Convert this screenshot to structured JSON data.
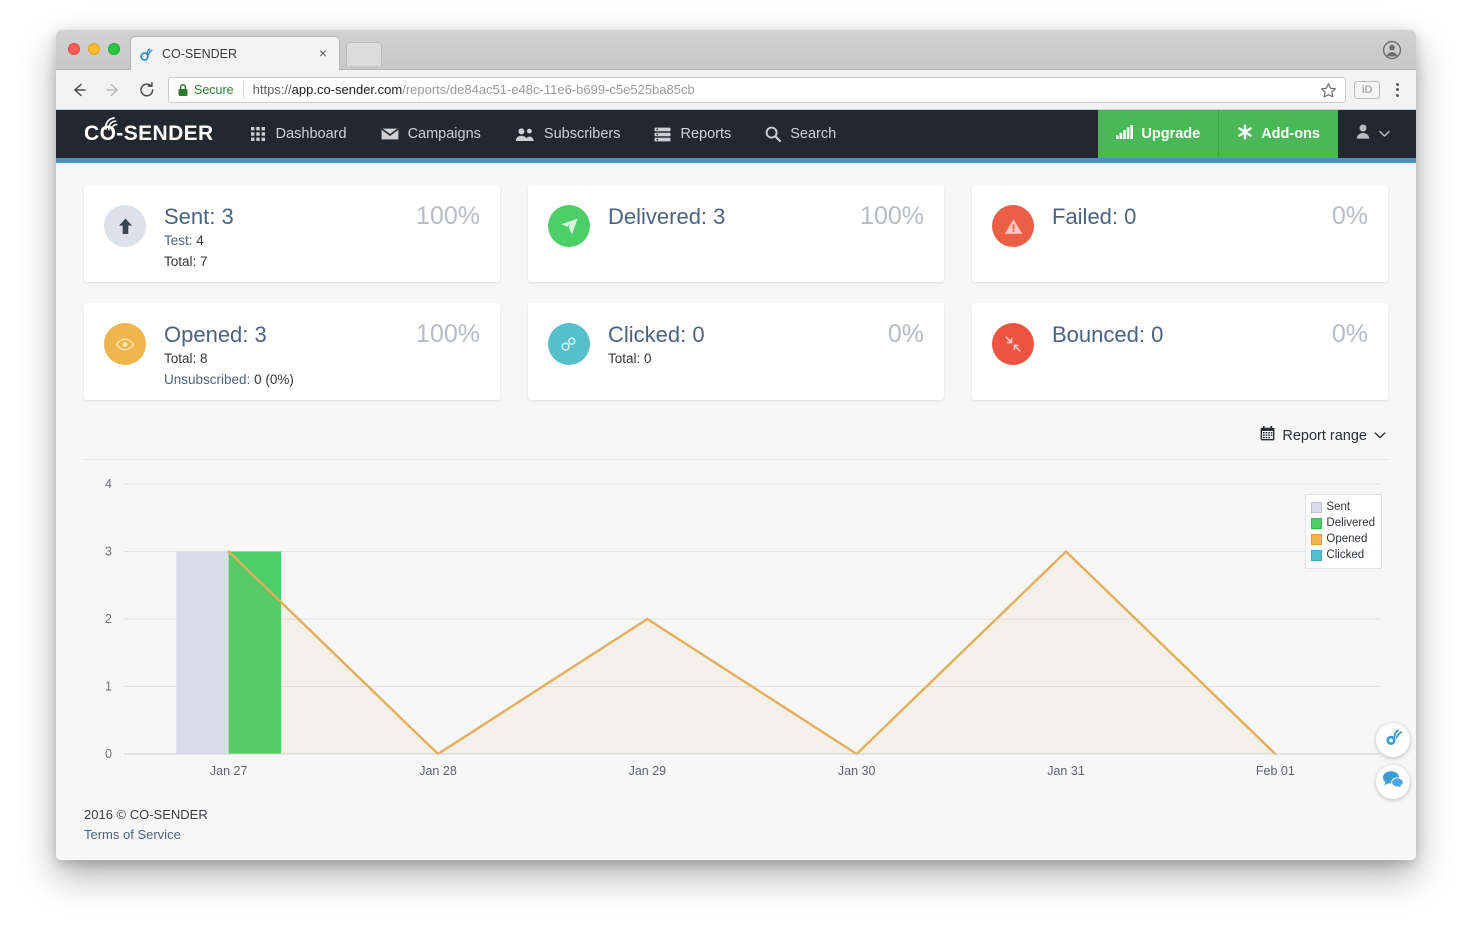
{
  "browser": {
    "tab": {
      "title": "CO-SENDER",
      "favicon": "co-sender-favicon",
      "close": "×"
    },
    "omnibox": {
      "secure_label": "Secure",
      "url_scheme": "https://",
      "url_host": "app.co-sender.com",
      "url_path": "/reports/de84ac51-e48c-11e6-b699-c5e525ba85cb",
      "url_full": "https://app.co-sender.com/reports/de84ac51-e48c-11e6-b699-c5e525ba85cb"
    },
    "extension_label": "iD"
  },
  "navbar": {
    "brand": "CO-SENDER",
    "links": [
      {
        "label": "Dashboard",
        "icon": "grid-icon"
      },
      {
        "label": "Campaigns",
        "icon": "envelope-icon"
      },
      {
        "label": "Subscribers",
        "icon": "users-icon"
      },
      {
        "label": "Reports",
        "icon": "server-icon"
      },
      {
        "label": "Search",
        "icon": "search-icon"
      }
    ],
    "upgrade": {
      "label": "Upgrade",
      "icon": "signal-bars-icon"
    },
    "addons": {
      "label": "Add-ons",
      "icon": "asterisk-icon"
    },
    "accent_color": "#4a93bd"
  },
  "stats": [
    {
      "title": "Sent: 3",
      "percent": "100%",
      "icon": "arrow-up-icon",
      "icon_bg": "#dde1e9",
      "icon_fg": "#3c4650",
      "sub": [
        {
          "key": "Test:",
          "value": "4"
        },
        {
          "key": "Total:",
          "value": "7"
        }
      ]
    },
    {
      "title": "Delivered: 3",
      "percent": "100%",
      "icon": "paper-plane-icon",
      "icon_bg": "#4cce68",
      "icon_fg": "#d9f5df",
      "sub": []
    },
    {
      "title": "Failed: 0",
      "percent": "0%",
      "icon": "warning-triangle-icon",
      "icon_bg": "#ec5e48",
      "icon_fg": "#f8c9c0",
      "sub": []
    },
    {
      "title": "Opened: 3",
      "percent": "100%",
      "icon": "eye-icon",
      "icon_bg": "#efb54a",
      "icon_fg": "#fbe6bd",
      "sub": [
        {
          "key": "Total:",
          "value": "8"
        },
        {
          "key": "Unsubscribed:",
          "value": "0 (0%)"
        }
      ]
    },
    {
      "title": "Clicked: 0",
      "percent": "0%",
      "icon": "link-chain-icon",
      "icon_bg": "#55c0cb",
      "icon_fg": "#cfeff2",
      "sub": [
        {
          "key": "Total:",
          "value": "0"
        }
      ]
    },
    {
      "title": "Bounced: 0",
      "percent": "0%",
      "icon": "compress-arrows-icon",
      "icon_bg": "#ec5340",
      "icon_fg": "#f9cdc6",
      "sub": []
    }
  ],
  "report_range": {
    "label": "Report range",
    "icon": "calendar-icon",
    "chevron": "chevron-down-icon"
  },
  "chart_data": {
    "type": "bar",
    "title": "",
    "xlabel": "",
    "ylabel": "",
    "categories": [
      "Jan 27",
      "Jan 28",
      "Jan 29",
      "Jan 30",
      "Jan 31",
      "Feb 01"
    ],
    "ylim": [
      0,
      4
    ],
    "yticks": [
      0,
      1,
      2,
      3,
      4
    ],
    "grid": true,
    "legend_position": "top-right",
    "series": [
      {
        "name": "Sent",
        "kind": "bar",
        "color": "#d7dce6",
        "values": [
          3,
          0,
          0,
          0,
          0,
          0
        ]
      },
      {
        "name": "Delivered",
        "kind": "bar",
        "color": "#4cce68",
        "values": [
          3,
          0,
          0,
          0,
          0,
          0
        ]
      },
      {
        "name": "Opened",
        "kind": "area",
        "color": "#e3af5c",
        "values": [
          3,
          0,
          2,
          0,
          3,
          0
        ]
      },
      {
        "name": "Clicked",
        "kind": "line",
        "color": "#55c0cb",
        "values": [
          0,
          0,
          0,
          0,
          0,
          0
        ]
      }
    ]
  },
  "footer": {
    "copyright": "2016 © CO-SENDER",
    "terms": "Terms of Service"
  },
  "widgets": [
    {
      "name": "co-sender-badge",
      "icon": "co-sender-mark-icon"
    },
    {
      "name": "chat-widget",
      "icon": "chat-bubbles-icon"
    }
  ]
}
